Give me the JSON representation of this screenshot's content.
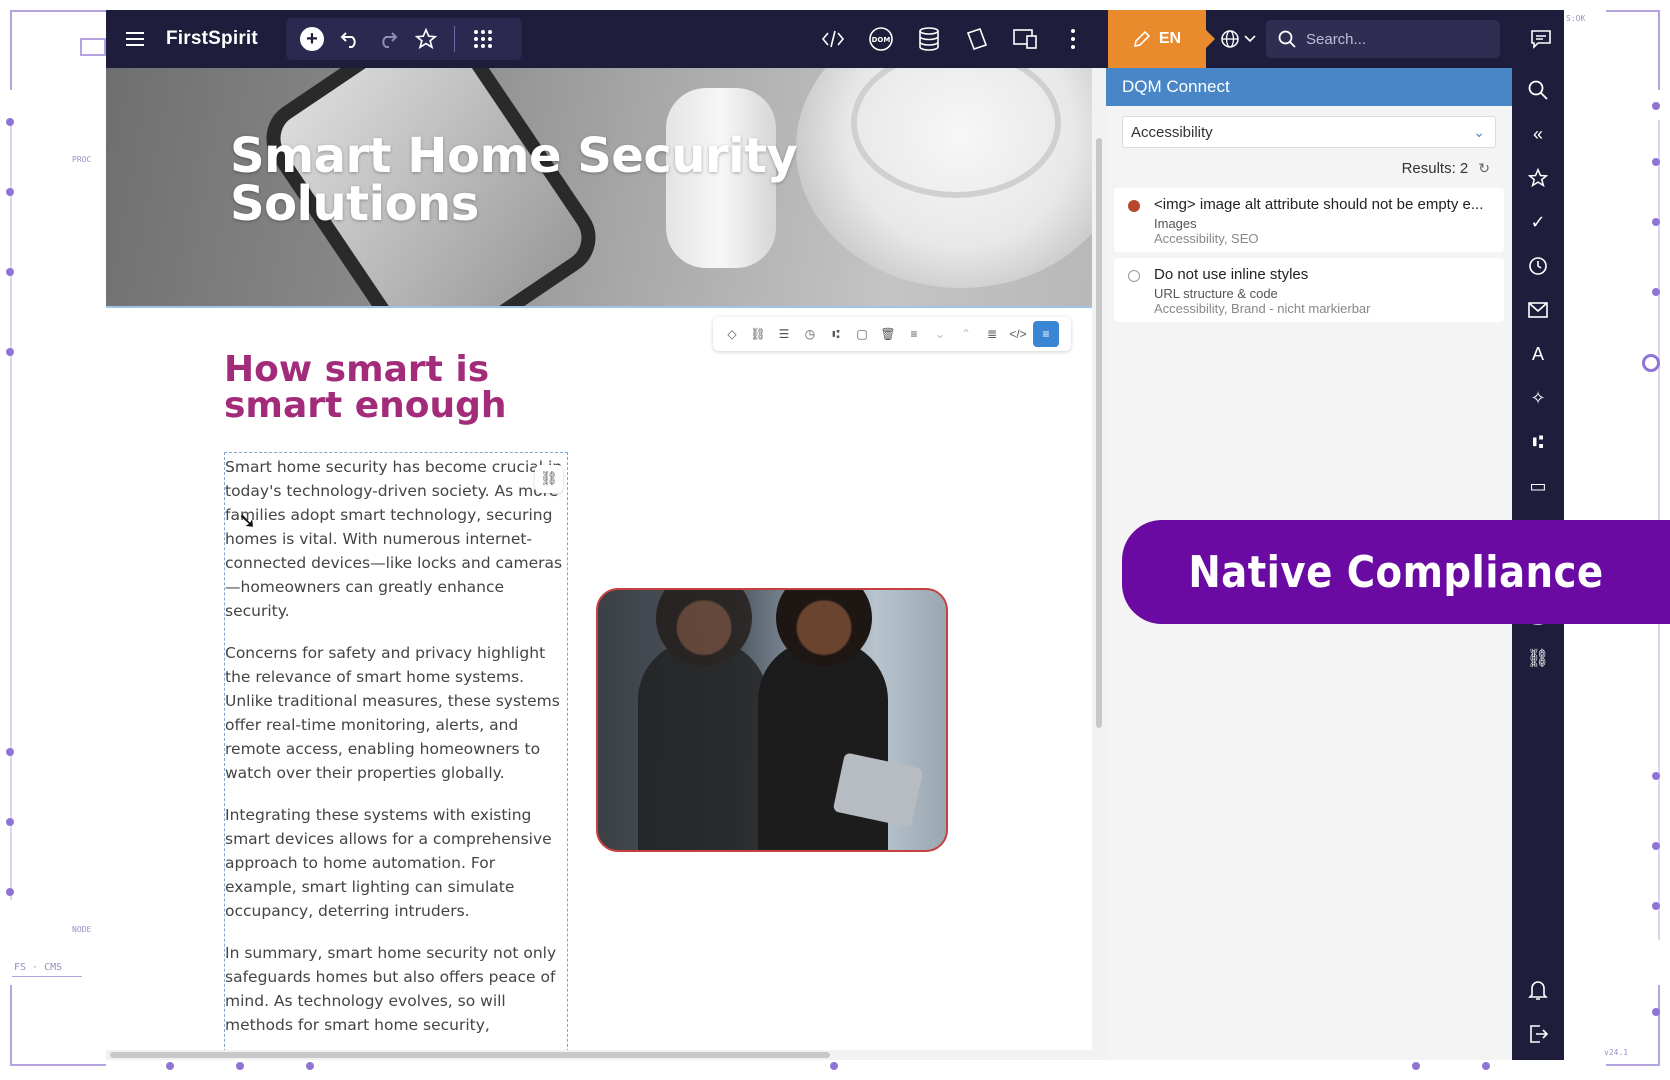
{
  "app": {
    "brand": "FirstSpirit"
  },
  "topbar": {
    "language": "EN",
    "search_placeholder": "Search...",
    "dom_label": "DOM"
  },
  "hero": {
    "title_line1": "Smart Home Security",
    "title_line2": "Solutions"
  },
  "article": {
    "heading_line1": "How smart is",
    "heading_line2": "smart enough",
    "paragraphs": [
      "Smart home security has become crucial in today's technology-driven society. As more families adopt smart technology, securing homes is vital. With numerous internet-connected devices—like locks and cameras—homeowners can greatly enhance security.",
      "Concerns for safety and privacy highlight the relevance of smart home systems. Unlike traditional measures, these systems offer real-time monitoring, alerts, and remote access, enabling homeowners to watch over their properties globally.",
      "Integrating these systems with existing smart devices allows for a comprehensive approach to home automation. For example, smart lighting can simulate occupancy, deterring intruders.",
      "In summary, smart home security not only safeguards homes but also offers peace of mind. As technology evolves, so will methods for smart home security,"
    ]
  },
  "dqm": {
    "title": "DQM Connect",
    "filter_value": "Accessibility",
    "results_label": "Results: 2",
    "items": [
      {
        "title": "<img> image alt attribute should not be empty e...",
        "subtitle": "Images",
        "categories": "Accessibility, SEO",
        "status_color": "#b5472c"
      },
      {
        "title": "Do not use inline styles",
        "subtitle": "URL structure & code",
        "categories": "Accessibility, Brand - nicht markierbar",
        "status_color": "#ffffff"
      }
    ]
  },
  "banner": {
    "text": "Native Compliance"
  },
  "deco": {
    "corner_label": "FS · CMS",
    "label_proc": "PROC",
    "label_node": "NODE",
    "label_top_right": "S:OK",
    "version": "v24.1"
  },
  "colors": {
    "topbar_bg": "#1f1d3c",
    "accent_orange": "#e98a2c",
    "heading_magenta": "#a32c7a",
    "dqm_header": "#4886c8",
    "banner_purple": "#6a0aa3"
  }
}
